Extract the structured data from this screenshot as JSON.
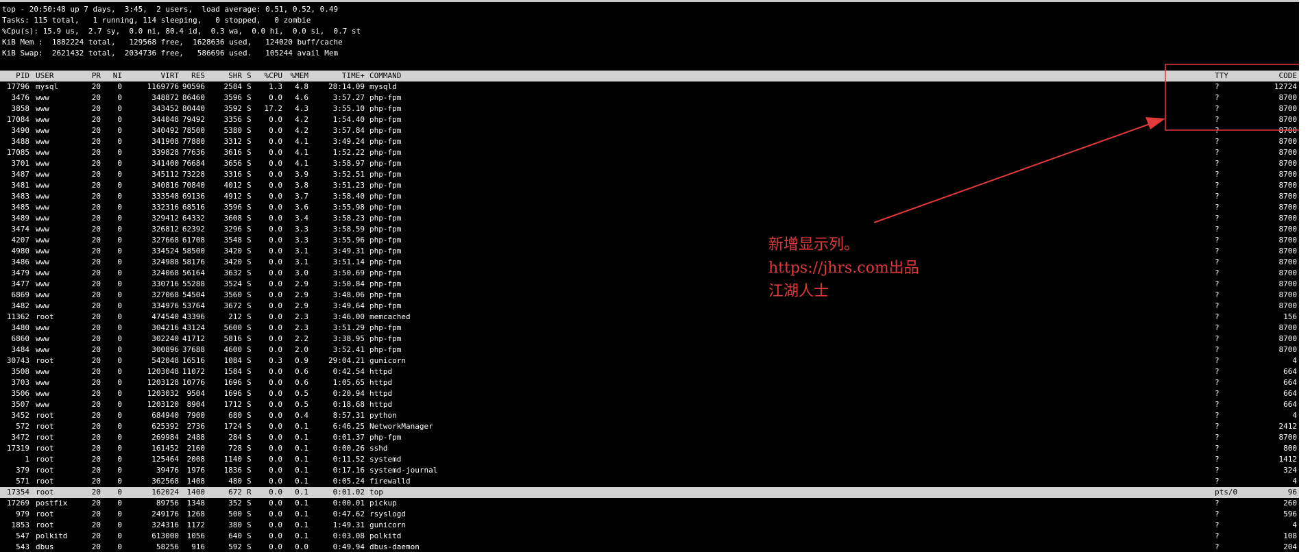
{
  "summary": [
    "top - 20:50:48 up 7 days,  3:45,  2 users,  load average: 0.51, 0.52, 0.49",
    "Tasks: 115 total,   1 running, 114 sleeping,   0 stopped,   0 zombie",
    "%Cpu(s): 15.9 us,  2.7 sy,  0.0 ni, 80.4 id,  0.3 wa,  0.0 hi,  0.0 si,  0.7 st",
    "KiB Mem :  1882224 total,   129568 free,  1628636 used,   124020 buff/cache",
    "KiB Swap:  2621432 total,  2034736 free,   586696 used.   105244 avail Mem"
  ],
  "columns": [
    "PID",
    "USER",
    "PR",
    "NI",
    "VIRT",
    "RES",
    "SHR",
    "S",
    "%CPU",
    "%MEM",
    "TIME+",
    "COMMAND",
    "TTY",
    "CODE"
  ],
  "processes": [
    [
      "17796",
      "mysql",
      "20",
      "0",
      "1169776",
      "90596",
      "2584",
      "S",
      "1.3",
      "4.8",
      "28:14.09",
      "mysqld",
      "?",
      "12724"
    ],
    [
      "3476",
      "www",
      "20",
      "0",
      "348872",
      "86460",
      "3596",
      "S",
      "0.0",
      "4.6",
      "3:57.27",
      "php-fpm",
      "?",
      "8700"
    ],
    [
      "3858",
      "www",
      "20",
      "0",
      "343452",
      "80440",
      "3592",
      "S",
      "17.2",
      "4.3",
      "3:55.10",
      "php-fpm",
      "?",
      "8700"
    ],
    [
      "17084",
      "www",
      "20",
      "0",
      "344048",
      "79492",
      "3356",
      "S",
      "0.0",
      "4.2",
      "1:54.40",
      "php-fpm",
      "?",
      "8700"
    ],
    [
      "3490",
      "www",
      "20",
      "0",
      "340492",
      "78500",
      "5380",
      "S",
      "0.0",
      "4.2",
      "3:57.84",
      "php-fpm",
      "?",
      "8700"
    ],
    [
      "3488",
      "www",
      "20",
      "0",
      "341908",
      "77880",
      "3312",
      "S",
      "0.0",
      "4.1",
      "3:49.24",
      "php-fpm",
      "?",
      "8700"
    ],
    [
      "17085",
      "www",
      "20",
      "0",
      "339828",
      "77636",
      "3616",
      "S",
      "0.0",
      "4.1",
      "1:52.22",
      "php-fpm",
      "?",
      "8700"
    ],
    [
      "3701",
      "www",
      "20",
      "0",
      "341400",
      "76684",
      "3656",
      "S",
      "0.0",
      "4.1",
      "3:58.97",
      "php-fpm",
      "?",
      "8700"
    ],
    [
      "3487",
      "www",
      "20",
      "0",
      "345112",
      "73228",
      "3316",
      "S",
      "0.0",
      "3.9",
      "3:52.51",
      "php-fpm",
      "?",
      "8700"
    ],
    [
      "3481",
      "www",
      "20",
      "0",
      "340816",
      "70840",
      "4012",
      "S",
      "0.0",
      "3.8",
      "3:51.23",
      "php-fpm",
      "?",
      "8700"
    ],
    [
      "3483",
      "www",
      "20",
      "0",
      "333548",
      "69136",
      "4912",
      "S",
      "0.0",
      "3.7",
      "3:58.40",
      "php-fpm",
      "?",
      "8700"
    ],
    [
      "3485",
      "www",
      "20",
      "0",
      "332316",
      "68516",
      "3596",
      "S",
      "0.0",
      "3.6",
      "3:55.98",
      "php-fpm",
      "?",
      "8700"
    ],
    [
      "3489",
      "www",
      "20",
      "0",
      "329412",
      "64332",
      "3608",
      "S",
      "0.0",
      "3.4",
      "3:58.23",
      "php-fpm",
      "?",
      "8700"
    ],
    [
      "3474",
      "www",
      "20",
      "0",
      "326812",
      "62392",
      "3296",
      "S",
      "0.0",
      "3.3",
      "3:58.59",
      "php-fpm",
      "?",
      "8700"
    ],
    [
      "4207",
      "www",
      "20",
      "0",
      "327668",
      "61708",
      "3548",
      "S",
      "0.0",
      "3.3",
      "3:55.96",
      "php-fpm",
      "?",
      "8700"
    ],
    [
      "4980",
      "www",
      "20",
      "0",
      "334524",
      "58500",
      "3420",
      "S",
      "0.0",
      "3.1",
      "3:49.31",
      "php-fpm",
      "?",
      "8700"
    ],
    [
      "3486",
      "www",
      "20",
      "0",
      "324988",
      "58176",
      "3420",
      "S",
      "0.0",
      "3.1",
      "3:51.14",
      "php-fpm",
      "?",
      "8700"
    ],
    [
      "3479",
      "www",
      "20",
      "0",
      "324068",
      "56164",
      "3632",
      "S",
      "0.0",
      "3.0",
      "3:50.69",
      "php-fpm",
      "?",
      "8700"
    ],
    [
      "3477",
      "www",
      "20",
      "0",
      "330716",
      "55288",
      "3524",
      "S",
      "0.0",
      "2.9",
      "3:50.84",
      "php-fpm",
      "?",
      "8700"
    ],
    [
      "6869",
      "www",
      "20",
      "0",
      "327068",
      "54504",
      "3560",
      "S",
      "0.0",
      "2.9",
      "3:48.06",
      "php-fpm",
      "?",
      "8700"
    ],
    [
      "3482",
      "www",
      "20",
      "0",
      "334976",
      "53764",
      "3672",
      "S",
      "0.0",
      "2.9",
      "3:49.64",
      "php-fpm",
      "?",
      "8700"
    ],
    [
      "11362",
      "root",
      "20",
      "0",
      "474540",
      "43396",
      "212",
      "S",
      "0.0",
      "2.3",
      "3:46.00",
      "memcached",
      "?",
      "156"
    ],
    [
      "3480",
      "www",
      "20",
      "0",
      "304216",
      "43124",
      "5600",
      "S",
      "0.0",
      "2.3",
      "3:51.29",
      "php-fpm",
      "?",
      "8700"
    ],
    [
      "6860",
      "www",
      "20",
      "0",
      "302240",
      "41712",
      "5816",
      "S",
      "0.0",
      "2.2",
      "3:38.95",
      "php-fpm",
      "?",
      "8700"
    ],
    [
      "3484",
      "www",
      "20",
      "0",
      "300896",
      "37688",
      "4600",
      "S",
      "0.0",
      "2.0",
      "3:52.41",
      "php-fpm",
      "?",
      "8700"
    ],
    [
      "30743",
      "root",
      "20",
      "0",
      "542048",
      "16516",
      "1084",
      "S",
      "0.3",
      "0.9",
      "29:04.21",
      "gunicorn",
      "?",
      "4"
    ],
    [
      "3508",
      "www",
      "20",
      "0",
      "1203048",
      "11072",
      "1584",
      "S",
      "0.0",
      "0.6",
      "0:42.54",
      "httpd",
      "?",
      "664"
    ],
    [
      "3703",
      "www",
      "20",
      "0",
      "1203128",
      "10776",
      "1696",
      "S",
      "0.0",
      "0.6",
      "1:05.65",
      "httpd",
      "?",
      "664"
    ],
    [
      "3506",
      "www",
      "20",
      "0",
      "1203032",
      "9504",
      "1696",
      "S",
      "0.0",
      "0.5",
      "0:20.94",
      "httpd",
      "?",
      "664"
    ],
    [
      "3507",
      "www",
      "20",
      "0",
      "1203120",
      "8904",
      "1712",
      "S",
      "0.0",
      "0.5",
      "0:18.68",
      "httpd",
      "?",
      "664"
    ],
    [
      "3452",
      "root",
      "20",
      "0",
      "684940",
      "7900",
      "680",
      "S",
      "0.0",
      "0.4",
      "8:57.31",
      "python",
      "?",
      "4"
    ],
    [
      "572",
      "root",
      "20",
      "0",
      "625392",
      "2736",
      "1724",
      "S",
      "0.0",
      "0.1",
      "6:46.25",
      "NetworkManager",
      "?",
      "2412"
    ],
    [
      "3472",
      "root",
      "20",
      "0",
      "269984",
      "2488",
      "284",
      "S",
      "0.0",
      "0.1",
      "0:01.37",
      "php-fpm",
      "?",
      "8700"
    ],
    [
      "17319",
      "root",
      "20",
      "0",
      "161452",
      "2160",
      "728",
      "S",
      "0.0",
      "0.1",
      "0:00.26",
      "sshd",
      "?",
      "800"
    ],
    [
      "1",
      "root",
      "20",
      "0",
      "125464",
      "2008",
      "1140",
      "S",
      "0.0",
      "0.1",
      "0:11.52",
      "systemd",
      "?",
      "1412"
    ],
    [
      "379",
      "root",
      "20",
      "0",
      "39476",
      "1976",
      "1836",
      "S",
      "0.0",
      "0.1",
      "0:17.16",
      "systemd-journal",
      "?",
      "324"
    ],
    [
      "571",
      "root",
      "20",
      "0",
      "362568",
      "1408",
      "480",
      "S",
      "0.0",
      "0.1",
      "0:05.24",
      "firewalld",
      "?",
      "4"
    ],
    [
      "17354",
      "root",
      "20",
      "0",
      "162024",
      "1400",
      "672",
      "R",
      "0.0",
      "0.1",
      "0:01.02",
      "top",
      "pts/0",
      "96"
    ],
    [
      "17269",
      "postfix",
      "20",
      "0",
      "89756",
      "1348",
      "352",
      "S",
      "0.0",
      "0.1",
      "0:00.01",
      "pickup",
      "?",
      "260"
    ],
    [
      "979",
      "root",
      "20",
      "0",
      "249176",
      "1268",
      "500",
      "S",
      "0.0",
      "0.1",
      "0:47.62",
      "rsyslogd",
      "?",
      "596"
    ],
    [
      "1853",
      "root",
      "20",
      "0",
      "324316",
      "1172",
      "380",
      "S",
      "0.0",
      "0.1",
      "1:49.31",
      "gunicorn",
      "?",
      "4"
    ],
    [
      "547",
      "polkitd",
      "20",
      "0",
      "613000",
      "1056",
      "640",
      "S",
      "0.0",
      "0.1",
      "0:03.08",
      "polkitd",
      "?",
      "108"
    ],
    [
      "543",
      "dbus",
      "20",
      "0",
      "58256",
      "916",
      "592",
      "S",
      "0.0",
      "0.0",
      "0:49.94",
      "dbus-daemon",
      "?",
      "204"
    ]
  ],
  "highlighted_pid": "17354",
  "annotation": {
    "lines": [
      "新增显示列。",
      "https://jhrs.com出品",
      "江湖人士"
    ],
    "color": "#e23a3a"
  }
}
